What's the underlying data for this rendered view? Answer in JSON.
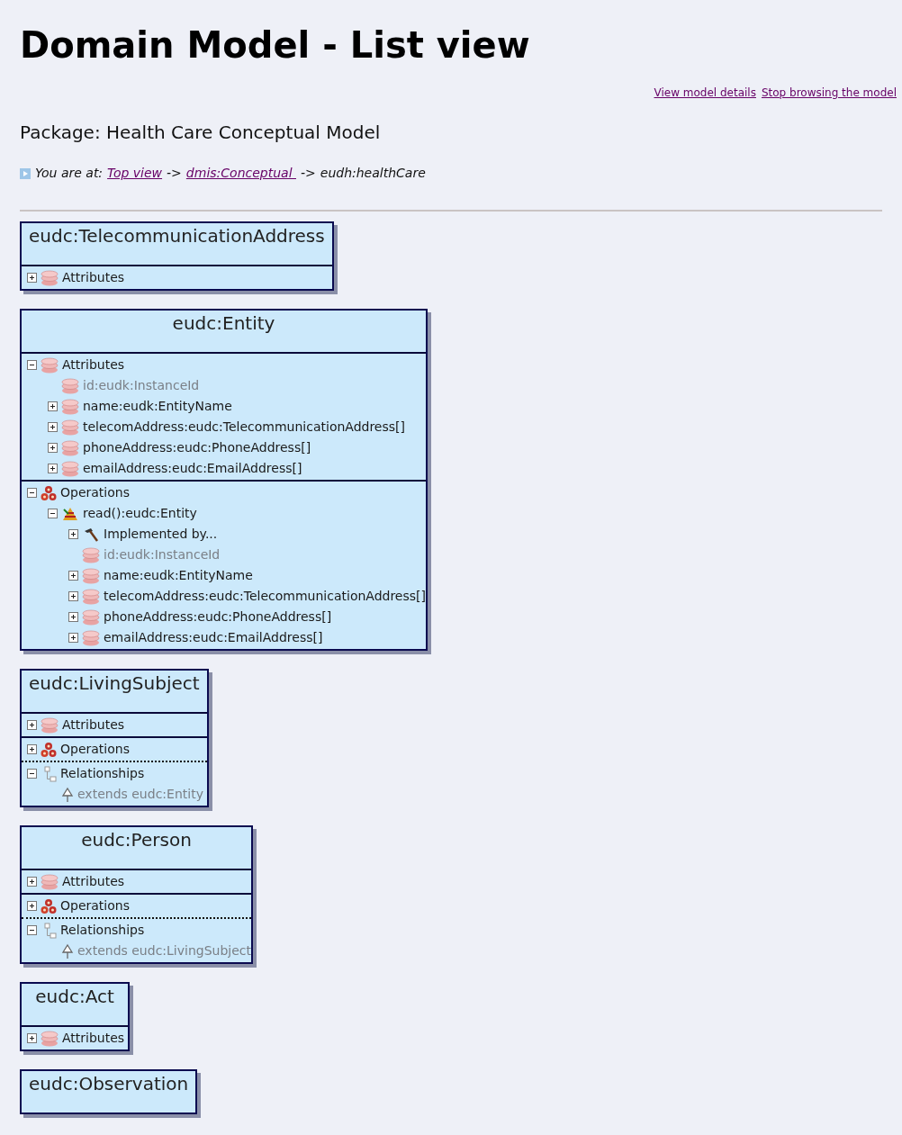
{
  "page_title": "Domain Model - List view",
  "top_links": [
    "View model details",
    "Stop browsing the model"
  ],
  "package_heading": "Package: Health Care Conceptual Model",
  "breadcrumb": {
    "prefix": "You are at:",
    "links": [
      "Top view",
      "dmis:Conceptual "
    ],
    "separator": "->",
    "current": "eudh:healthCare"
  },
  "classes": [
    {
      "title": "eudc:TelecommunicationAddress",
      "sections": [
        {
          "kind": "attributes",
          "label": "Attributes",
          "expanded": false
        }
      ]
    },
    {
      "title": "eudc:Entity",
      "sections": [
        {
          "kind": "attributes",
          "label": "Attributes",
          "expanded": true,
          "children": [
            {
              "kind": "attribute",
              "label": "id:eudk:InstanceId",
              "expandable": false
            },
            {
              "kind": "attribute",
              "label": "name:eudk:EntityName",
              "expandable": true,
              "expanded": false
            },
            {
              "kind": "attribute",
              "label": "telecomAddress:eudc:TelecommunicationAddress[]",
              "expandable": true,
              "expanded": false
            },
            {
              "kind": "attribute",
              "label": "phoneAddress:eudc:PhoneAddress[]",
              "expandable": true,
              "expanded": false
            },
            {
              "kind": "attribute",
              "label": "emailAddress:eudc:EmailAddress[]",
              "expandable": true,
              "expanded": false
            }
          ]
        },
        {
          "kind": "operations",
          "label": "Operations",
          "expanded": true,
          "children": [
            {
              "kind": "method",
              "label": "read():eudc:Entity",
              "expandable": true,
              "expanded": true,
              "children": [
                {
                  "kind": "implementation",
                  "label": "Implemented by...",
                  "expandable": true,
                  "expanded": false
                },
                {
                  "kind": "attribute",
                  "label": "id:eudk:InstanceId",
                  "expandable": false
                },
                {
                  "kind": "attribute",
                  "label": "name:eudk:EntityName",
                  "expandable": true,
                  "expanded": false
                },
                {
                  "kind": "attribute",
                  "label": "telecomAddress:eudc:TelecommunicationAddress[]",
                  "expandable": true,
                  "expanded": false
                },
                {
                  "kind": "attribute",
                  "label": "phoneAddress:eudc:PhoneAddress[]",
                  "expandable": true,
                  "expanded": false
                },
                {
                  "kind": "attribute",
                  "label": "emailAddress:eudc:EmailAddress[]",
                  "expandable": true,
                  "expanded": false
                }
              ]
            }
          ]
        }
      ]
    },
    {
      "title": "eudc:LivingSubject",
      "sections": [
        {
          "kind": "attributes",
          "label": "Attributes",
          "expanded": false
        },
        {
          "kind": "operations",
          "label": "Operations",
          "expanded": false
        },
        {
          "kind": "relationships",
          "label": "Relationships",
          "expanded": true,
          "children": [
            {
              "kind": "extends",
              "label": "extends eudc:Entity",
              "expandable": false
            }
          ]
        }
      ]
    },
    {
      "title": "eudc:Person",
      "sections": [
        {
          "kind": "attributes",
          "label": "Attributes",
          "expanded": false
        },
        {
          "kind": "operations",
          "label": "Operations",
          "expanded": false
        },
        {
          "kind": "relationships",
          "label": "Relationships",
          "expanded": true,
          "children": [
            {
              "kind": "extends",
              "label": "extends eudc:LivingSubject",
              "expandable": false
            }
          ]
        }
      ]
    },
    {
      "title": "eudc:Act",
      "sections": [
        {
          "kind": "attributes",
          "label": "Attributes",
          "expanded": false
        }
      ]
    },
    {
      "title": "eudc:Observation"
    }
  ]
}
